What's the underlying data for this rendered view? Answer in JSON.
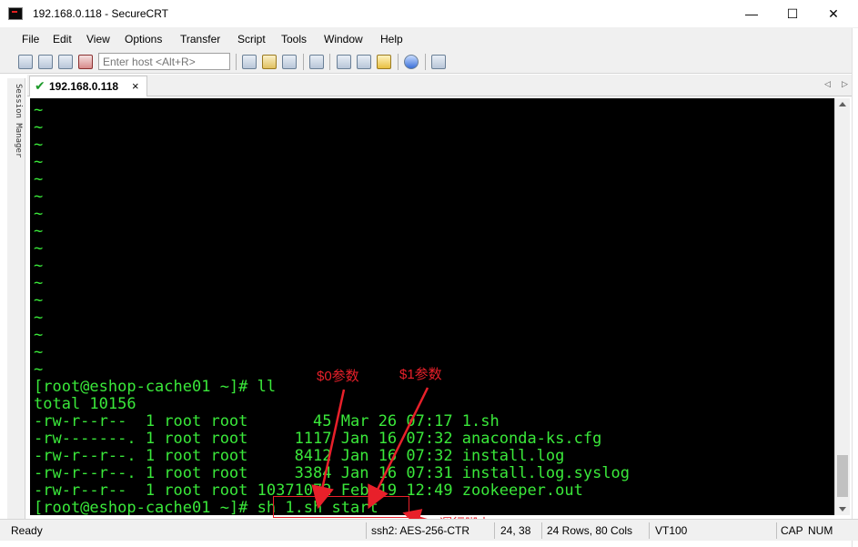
{
  "window": {
    "title": "192.168.0.118 - SecureCRT",
    "minimize_glyph": "—",
    "maximize_glyph": "☐",
    "close_glyph": "✕"
  },
  "menu": [
    {
      "label": "File"
    },
    {
      "label": "Edit"
    },
    {
      "label": "View"
    },
    {
      "label": "Options"
    },
    {
      "label": "Transfer"
    },
    {
      "label": "Script"
    },
    {
      "label": "Tools"
    },
    {
      "label": "Window"
    },
    {
      "label": "Help"
    }
  ],
  "toolbar": {
    "host_placeholder": "Enter host <Alt+R>"
  },
  "session_manager": {
    "label": "Session Manager"
  },
  "tab": {
    "label": "192.168.0.118",
    "close_glyph": "×",
    "status_icon": "check-icon",
    "nav_prev": "◁",
    "nav_next": "▷",
    "menu_glyph": "▼"
  },
  "terminal": {
    "lines": [
      "~",
      "~",
      "~",
      "~",
      "~",
      "~",
      "~",
      "~",
      "~",
      "~",
      "~",
      "~",
      "~",
      "~",
      "~",
      "~",
      "[root@eshop-cache01 ~]# ll",
      "total 10156",
      "-rw-r--r--  1 root root       45 Mar 26 07:17 1.sh",
      "-rw-------. 1 root root     1117 Jan 16 07:32 anaconda-ks.cfg",
      "-rw-r--r--. 1 root root     8412 Jan 16 07:32 install.log",
      "-rw-r--r--. 1 root root     3384 Jan 16 07:31 install.log.syslog",
      "-rw-r--r--  1 root root 10371072 Feb 19 12:49 zookeeper.out",
      "[root@eshop-cache01 ~]# sh 1.sh start"
    ],
    "colors": {
      "background": "#000000",
      "foreground": "#3ae83a"
    }
  },
  "annotations": {
    "param0": "$0参数",
    "param1": "$1参数",
    "run_script": "運行脚本",
    "color": "#e8202a"
  },
  "status": {
    "ready": "Ready",
    "cipher": "ssh2: AES-256-CTR",
    "cursor": "24,  38",
    "size": "24 Rows, 80 Cols",
    "emulation": "VT100",
    "caps": "CAP",
    "num": "NUM"
  }
}
